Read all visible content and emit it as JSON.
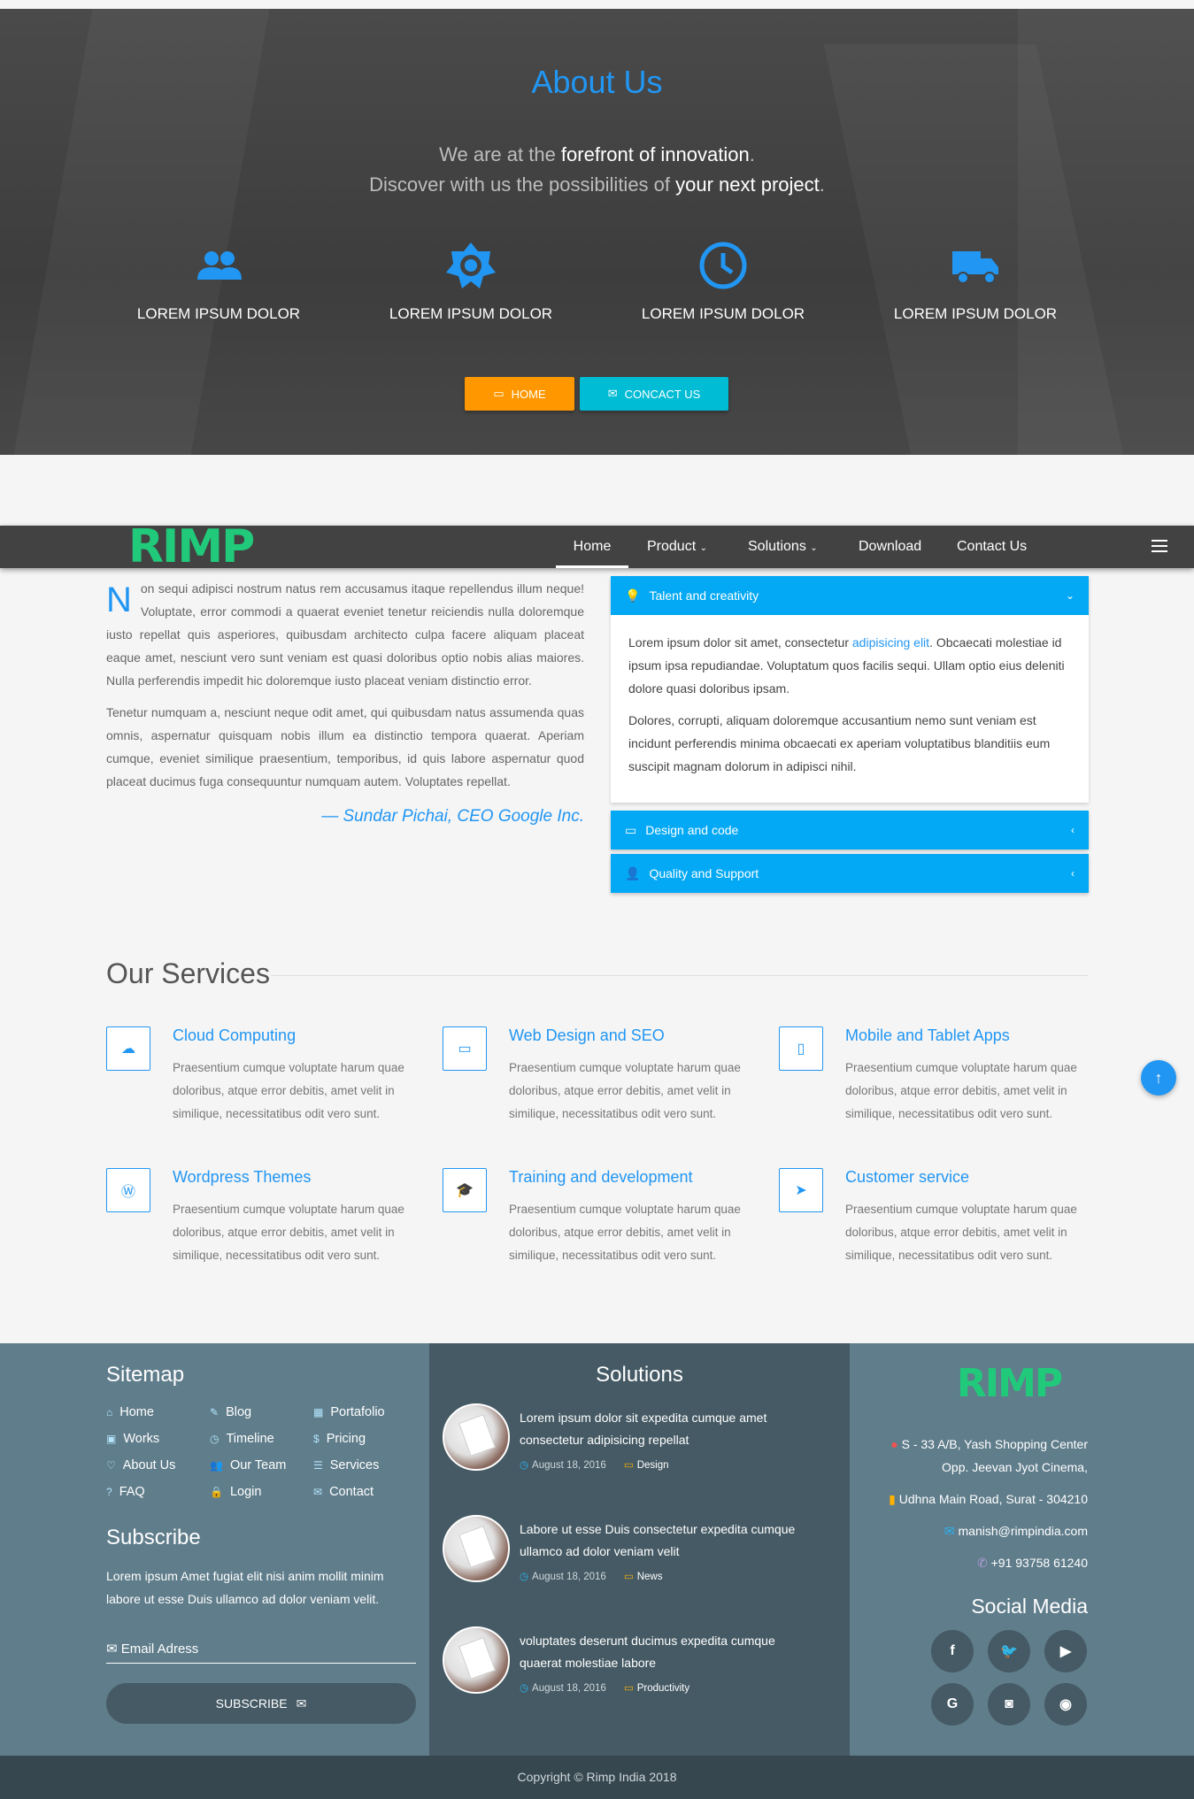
{
  "hero": {
    "title": "About Us",
    "line1_a": "We are at the ",
    "line1_b": "forefront of innovation",
    "line1_c": ".",
    "line2_a": "Discover with us the possibilities of ",
    "line2_b": "your next project",
    "line2_c": ".",
    "features": [
      {
        "icon": "people-icon",
        "label": "LOREM IPSUM DOLOR"
      },
      {
        "icon": "brightness-icon",
        "label": "LOREM IPSUM DOLOR"
      },
      {
        "icon": "clock-icon",
        "label": "LOREM IPSUM DOLOR"
      },
      {
        "icon": "truck-icon",
        "label": "LOREM IPSUM DOLOR"
      }
    ],
    "btn_home": "HOME",
    "btn_contact": "CONCACT US"
  },
  "navbar": {
    "logo": "RIMP",
    "items": [
      "Home",
      "Product",
      "Solutions",
      "Download",
      "Contact Us"
    ]
  },
  "about": {
    "drop": "N",
    "p1": "on sequi adipisci nostrum natus rem accusamus itaque repellendus illum neque! Voluptate, error commodi a quaerat eveniet tenetur reiciendis nulla doloremque iusto repellat quis asperiores, quibusdam architecto culpa facere aliquam placeat eaque amet, nesciunt vero sunt veniam est quasi doloribus optio nobis alias maiores. Nulla perferendis impedit hic doloremque iusto placeat veniam distinctio error.",
    "p2": "Tenetur numquam a, nesciunt neque odit amet, qui quibusdam natus assumenda quas omnis, aspernatur quisquam nobis illum ea distinctio tempora quaerat. Aperiam cumque, eveniet similique praesentium, temporibus, id quis labore aspernatur quod placeat ducimus fuga consequuntur numquam autem. Voluptates repellat.",
    "quote": "— Sundar Pichai, CEO Google Inc."
  },
  "accordion": {
    "item1": "Talent and creativity",
    "body_a": "Lorem ipsum dolor sit amet, consectetur ",
    "body_link": "adipisicing elit",
    "body_b": ". Obcaecati molestiae id ipsum ipsa repudiandae. Voluptatum quos facilis sequi. Ullam optio eius deleniti dolore quasi doloribus ipsam.",
    "body_p2": "Dolores, corrupti, aliquam doloremque accusantium nemo sunt veniam est incidunt perferendis minima obcaecati ex aperiam voluptatibus blanditiis eum suscipit magnam dolorum in adipisci nihil.",
    "item2": "Design and code",
    "item3": "Quality and Support"
  },
  "services": {
    "title": "Our Services",
    "items": [
      {
        "title": "Cloud Computing",
        "icon": "cloud-icon",
        "text": "Praesentium cumque voluptate harum quae doloribus, atque error debitis, amet velit in similique, necessitatibus odit vero sunt."
      },
      {
        "title": "Web Design and SEO",
        "icon": "monitor-icon",
        "text": "Praesentium cumque voluptate harum quae doloribus, atque error debitis, amet velit in similique, necessitatibus odit vero sunt."
      },
      {
        "title": "Mobile and Tablet Apps",
        "icon": "tablet-icon",
        "text": "Praesentium cumque voluptate harum quae doloribus, atque error debitis, amet velit in similique, necessitatibus odit vero sunt."
      },
      {
        "title": "Wordpress Themes",
        "icon": "wordpress-icon",
        "text": "Praesentium cumque voluptate harum quae doloribus, atque error debitis, amet velit in similique, necessitatibus odit vero sunt."
      },
      {
        "title": "Training and development",
        "icon": "graduation-cap-icon",
        "text": "Praesentium cumque voluptate harum quae doloribus, atque error debitis, amet velit in similique, necessitatibus odit vero sunt."
      },
      {
        "title": "Customer service",
        "icon": "paper-plane-icon",
        "text": "Praesentium cumque voluptate harum quae doloribus, atque error debitis, amet velit in similique, necessitatibus odit vero sunt."
      }
    ]
  },
  "footer": {
    "sitemap_title": "Sitemap",
    "sitemap": [
      "Home",
      "Blog",
      "Portafolio",
      "Works",
      "Timeline",
      "Pricing",
      "About Us",
      "Our Team",
      "Services",
      "FAQ",
      "Login",
      "Contact"
    ],
    "subscribe_title": "Subscribe",
    "subscribe_text": "Lorem ipsum Amet fugiat elit nisi anim mollit minim labore ut esse Duis ullamco ad dolor veniam velit.",
    "email_placeholder": "Email Adress",
    "subscribe_btn": "SUBSCRIBE",
    "solutions_title": "Solutions",
    "posts": [
      {
        "title": "Lorem ipsum dolor sit expedita cumque amet consectetur adipisicing repellat",
        "date": "August 18, 2016",
        "cat": "Design"
      },
      {
        "title": "Labore ut esse Duis consectetur expedita cumque ullamco ad dolor veniam velit",
        "date": "August 18, 2016",
        "cat": "News"
      },
      {
        "title": "voluptates deserunt ducimus expedita cumque quaerat molestiae labore",
        "date": "August 18, 2016",
        "cat": "Productivity"
      }
    ],
    "logo": "RIMP",
    "addr1": "S - 33 A/B, Yash Shopping Center",
    "addr2": "Opp. Jeevan Jyot Cinema,",
    "addr3": "Udhna Main Road, Surat - 304210",
    "email": "manish@rimpindia.com",
    "phone": "+91 93758 61240",
    "social_title": "Social Media",
    "copyright": "Copyright © Rimp India 2018"
  }
}
